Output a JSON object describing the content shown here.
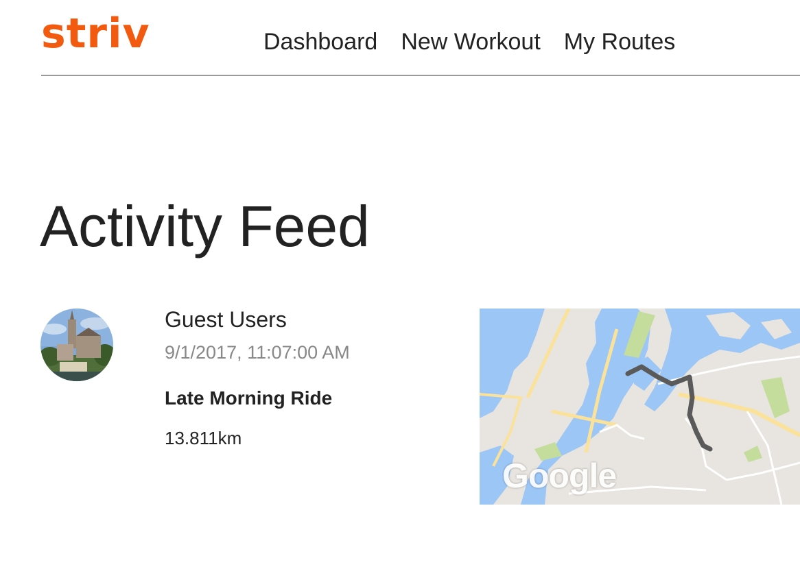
{
  "header": {
    "logo_text": "striv",
    "nav": {
      "dashboard": "Dashboard",
      "new_workout": "New Workout",
      "my_routes": "My Routes"
    }
  },
  "page_title": "Activity Feed",
  "feed": {
    "items": [
      {
        "user": "Guest Users",
        "timestamp": "9/1/2017, 11:07:00 AM",
        "title": "Late Morning Ride",
        "distance": "13.811km",
        "map_attribution": "Google"
      }
    ]
  },
  "colors": {
    "brand": "#f25a10",
    "text": "#222222",
    "muted": "#888888",
    "water": "#9cc6f5",
    "land": "#e8e4df",
    "park": "#c4dd9c",
    "road_major": "#fbe29a",
    "route": "#5a5a5a"
  }
}
